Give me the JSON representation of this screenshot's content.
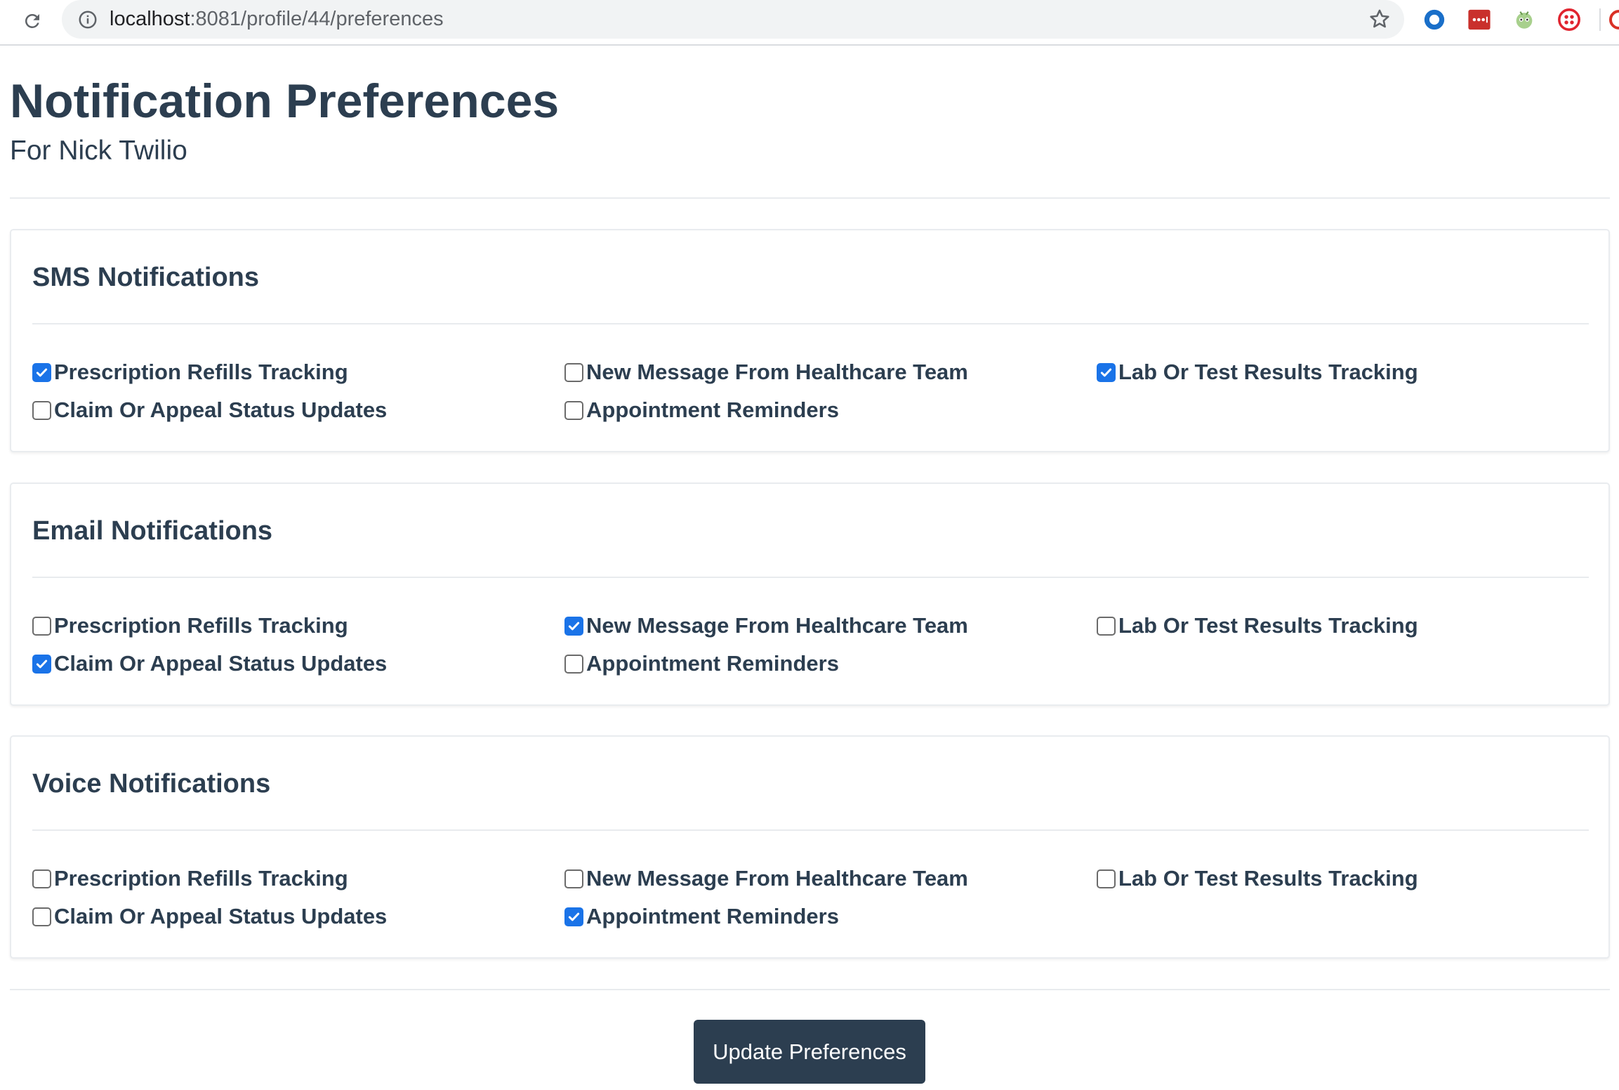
{
  "browser": {
    "url_host": "localhost",
    "url_path": ":8081/profile/44/preferences",
    "extensions": [
      "circle-extension-icon",
      "lastpass-icon",
      "bug-extension-icon",
      "twilio-icon"
    ]
  },
  "page": {
    "title": "Notification Preferences",
    "subtitle": "For Nick Twilio"
  },
  "colors": {
    "text": "#2c3e50",
    "checkbox_checked": "#1a73e8",
    "button_bg": "#2c3e50",
    "button_text": "#ffffff"
  },
  "sections": [
    {
      "title": "SMS Notifications",
      "options": [
        {
          "label": "Prescription Refills Tracking",
          "checked": true
        },
        {
          "label": "New Message From Healthcare Team",
          "checked": false
        },
        {
          "label": "Lab Or Test Results Tracking",
          "checked": true
        },
        {
          "label": "Claim Or Appeal Status Updates",
          "checked": false
        },
        {
          "label": "Appointment Reminders",
          "checked": false
        }
      ]
    },
    {
      "title": "Email Notifications",
      "options": [
        {
          "label": "Prescription Refills Tracking",
          "checked": false
        },
        {
          "label": "New Message From Healthcare Team",
          "checked": true
        },
        {
          "label": "Lab Or Test Results Tracking",
          "checked": false
        },
        {
          "label": "Claim Or Appeal Status Updates",
          "checked": true
        },
        {
          "label": "Appointment Reminders",
          "checked": false
        }
      ]
    },
    {
      "title": "Voice Notifications",
      "options": [
        {
          "label": "Prescription Refills Tracking",
          "checked": false
        },
        {
          "label": "New Message From Healthcare Team",
          "checked": false
        },
        {
          "label": "Lab Or Test Results Tracking",
          "checked": false
        },
        {
          "label": "Claim Or Appeal Status Updates",
          "checked": false
        },
        {
          "label": "Appointment Reminders",
          "checked": true
        }
      ]
    }
  ],
  "actions": {
    "submit_label": "Update Preferences"
  }
}
